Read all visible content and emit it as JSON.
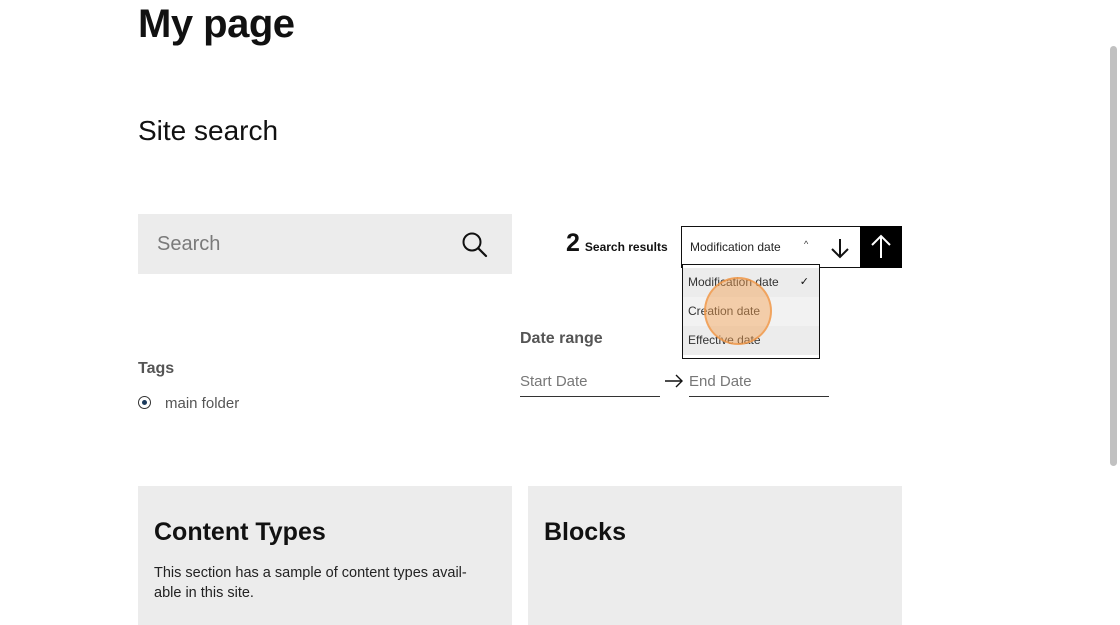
{
  "page": {
    "title": "My page"
  },
  "search": {
    "heading": "Site search",
    "placeholder": "Search",
    "value": "",
    "icon": "search-icon"
  },
  "results": {
    "count": "2",
    "label": "Search results"
  },
  "sort": {
    "selected": "Modification date",
    "caret": "^",
    "options": [
      {
        "label": "Modification date",
        "selected": true,
        "check": "✓"
      },
      {
        "label": "Creation date",
        "selected": false
      },
      {
        "label": "Effective date",
        "selected": false
      }
    ],
    "descending_icon": "arrow-down-icon",
    "ascending_icon": "arrow-up-icon"
  },
  "date_range": {
    "label": "Date range",
    "start_placeholder": "Start Date",
    "end_placeholder": "End Date",
    "arrow_icon": "arrow-right-icon"
  },
  "tags": {
    "label": "Tags",
    "items": [
      {
        "label": "main folder",
        "checked": true
      }
    ]
  },
  "cards": [
    {
      "title": "Content Types",
      "text": "This section has a sample of content types avail-able in this site."
    },
    {
      "title": "Blocks",
      "text": ""
    }
  ],
  "colors": {
    "panel": "#ececec",
    "accent_button": "#000000",
    "click_marker": "#f5a050"
  }
}
